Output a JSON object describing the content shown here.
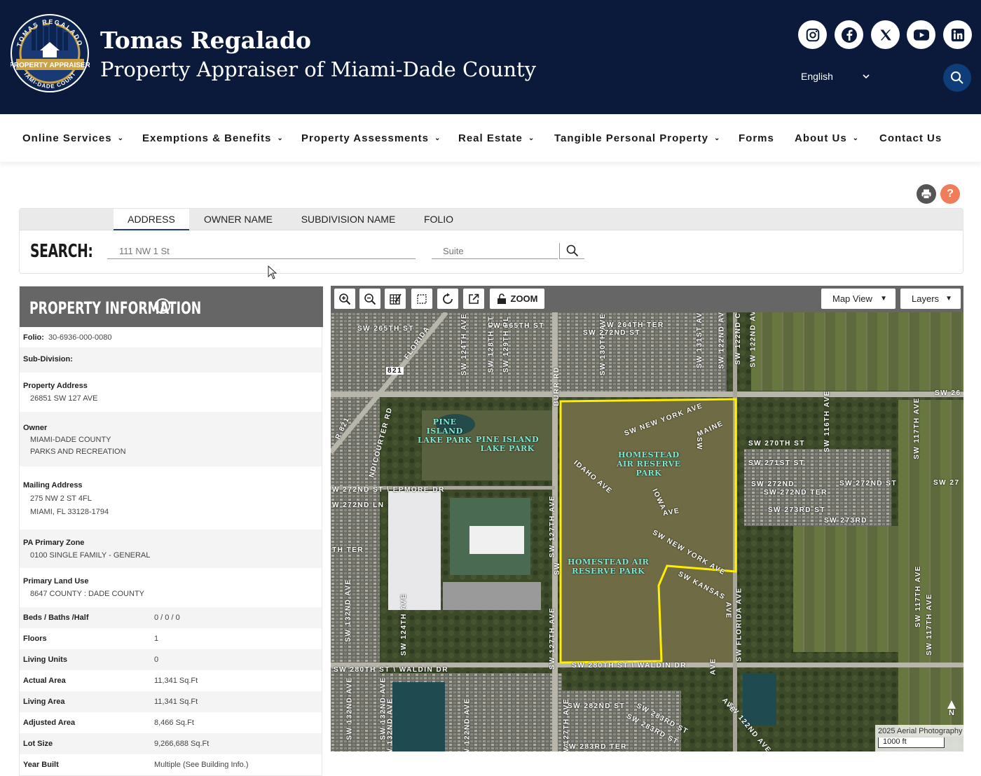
{
  "header": {
    "title_line1": "Tomas Regalado",
    "title_line2": "Property Appraiser of Miami-Dade County",
    "logo": {
      "top_text": "TOMAS REGALADO",
      "band_text": "PROPERTY APPRAISER",
      "bottom_text": "MIAMI-DADE COUNTY"
    },
    "social_icons": [
      "instagram-icon",
      "facebook-icon",
      "x-icon",
      "youtube-icon",
      "linkedin-icon"
    ],
    "language": "English",
    "colors": {
      "bg": "#0b1a3a",
      "accent": "#0e3d7a"
    }
  },
  "nav": {
    "items": [
      {
        "label": "Online Services",
        "dropdown": true
      },
      {
        "label": "Exemptions & Benefits",
        "dropdown": true
      },
      {
        "label": "Property Assessments",
        "dropdown": true
      },
      {
        "label": "Real Estate",
        "dropdown": true
      },
      {
        "label": "Tangible Personal Property",
        "dropdown": true
      },
      {
        "label": "Forms",
        "dropdown": false
      },
      {
        "label": "About Us",
        "dropdown": true
      },
      {
        "label": "Contact Us",
        "dropdown": false
      }
    ]
  },
  "tools": {
    "print_icon": "print-icon",
    "help_icon": "help-icon",
    "help_color": "#f07c5a"
  },
  "search": {
    "tabs": [
      "ADDRESS",
      "OWNER NAME",
      "SUBDIVISION NAME",
      "FOLIO"
    ],
    "active_tab": "ADDRESS",
    "label": "SEARCH:",
    "address_placeholder": "111 NW 1 St",
    "suite_placeholder": "Suite"
  },
  "property_info": {
    "title": "PROPERTY INFORMATION",
    "folio_label": "Folio:",
    "folio": "30-6936-000-0080",
    "subdivision_label": "Sub-Division:",
    "address_label": "Property Address",
    "address": "26851 SW 127 AVE",
    "owner_label": "Owner",
    "owner_line1": "MIAMI-DADE COUNTY",
    "owner_line2": "PARKS AND RECREATION",
    "mailing_label": "Mailing Address",
    "mailing_line1": "275 NW 2 ST 4FL",
    "mailing_line2": "MIAMI, FL 33128-1794",
    "zone_label": "PA Primary Zone",
    "zone": "0100 SINGLE FAMILY - GENERAL",
    "land_use_label": "Primary Land Use",
    "land_use": "8647 COUNTY : DADE COUNTY",
    "facts": [
      {
        "label": "Beds / Baths /Half",
        "value": "0 / 0 / 0"
      },
      {
        "label": "Floors",
        "value": "1"
      },
      {
        "label": "Living Units",
        "value": "0"
      },
      {
        "label": "Actual Area",
        "value": "11,341 Sq.Ft"
      },
      {
        "label": "Living Area",
        "value": "11,341 Sq.Ft"
      },
      {
        "label": "Adjusted Area",
        "value": "8,466 Sq.Ft"
      },
      {
        "label": "Lot Size",
        "value": "9,266,688 Sq.Ft"
      },
      {
        "label": "Year Built",
        "value": "Multiple (See Building Info.)"
      }
    ]
  },
  "map": {
    "zoom_label": "ZOOM",
    "view_select": "Map View",
    "layers_select": "Layers",
    "tool_icons": [
      "zoom-in-icon",
      "zoom-out-icon",
      "measure-icon",
      "select-box-icon",
      "refresh-icon",
      "external-link-icon",
      "lock-icon"
    ],
    "road_labels": [
      "SW 265TH ST",
      "SW 265TH ST",
      "SW 264TH TER",
      "SW 26",
      "FLORIDA",
      "821",
      "SW 272ND ST",
      "SW 27",
      "W 272ND ST \\ EPMORE DR",
      "SW NEW YORK AVE",
      "MAINE",
      "SW",
      "SW 270TH ST",
      "SW 271ST ST",
      "SW 272ND TER",
      "SW 273RD ST",
      "SW 273RD",
      "IDAHO AVE",
      "IOWA",
      "AVE",
      "SW NEW YORK AVE",
      "SW KANSAS",
      "AVE",
      "SW 280TH ST \\ WALDIN DR",
      "SW 280TH ST \\ WALDIN DR",
      "SW 282ND ST",
      "SW 283RD ST",
      "SW 283RD TER",
      "SW 132ND AVE",
      "SW 127TH AVE",
      "SW 117TH AVE",
      "BURR RD",
      "SW FLORIDA AVE",
      "SW 122ND AVE",
      "SW 124TH AVE",
      "SW 128TH CT",
      "SW 129TH PL",
      "SW 130TH AVE",
      "SW 131ST AVE",
      "SW 122ND CT",
      "SW 122ND AVE",
      "SW 116TH AVE",
      "R 821",
      "NDICOURTER RD",
      "W 272ND LN",
      "TH TER",
      "SW 132ND AVE",
      "SW 127TH AVE",
      "SW",
      "AVE",
      "SW 132ND AVE",
      "SW 127TH AVE",
      "SW 122ND AVE",
      "SW 283RD ST",
      "SW 122ND AVE",
      "AVE",
      "SW 124TH AVE",
      "SW 132ND AVE",
      "SW 272ND ST",
      "SW 117TH AVE",
      "SW 117TH AVE",
      "SW 272ND"
    ],
    "park_labels": [
      {
        "lines": [
          "PINE",
          "ISLAND",
          "LAKE PARK"
        ]
      },
      {
        "lines": [
          "PINE ISLAND",
          "LAKE PARK"
        ]
      },
      {
        "lines": [
          "HOMESTEAD",
          "AIR RESERVE",
          "PARK"
        ]
      },
      {
        "lines": [
          "HOMESTEAD AIR",
          "RESERVE PARK"
        ]
      }
    ],
    "caption": "2025 Aerial Photography",
    "scale": "1000 ft",
    "north": "N",
    "parcel_color": "#ffee00"
  }
}
